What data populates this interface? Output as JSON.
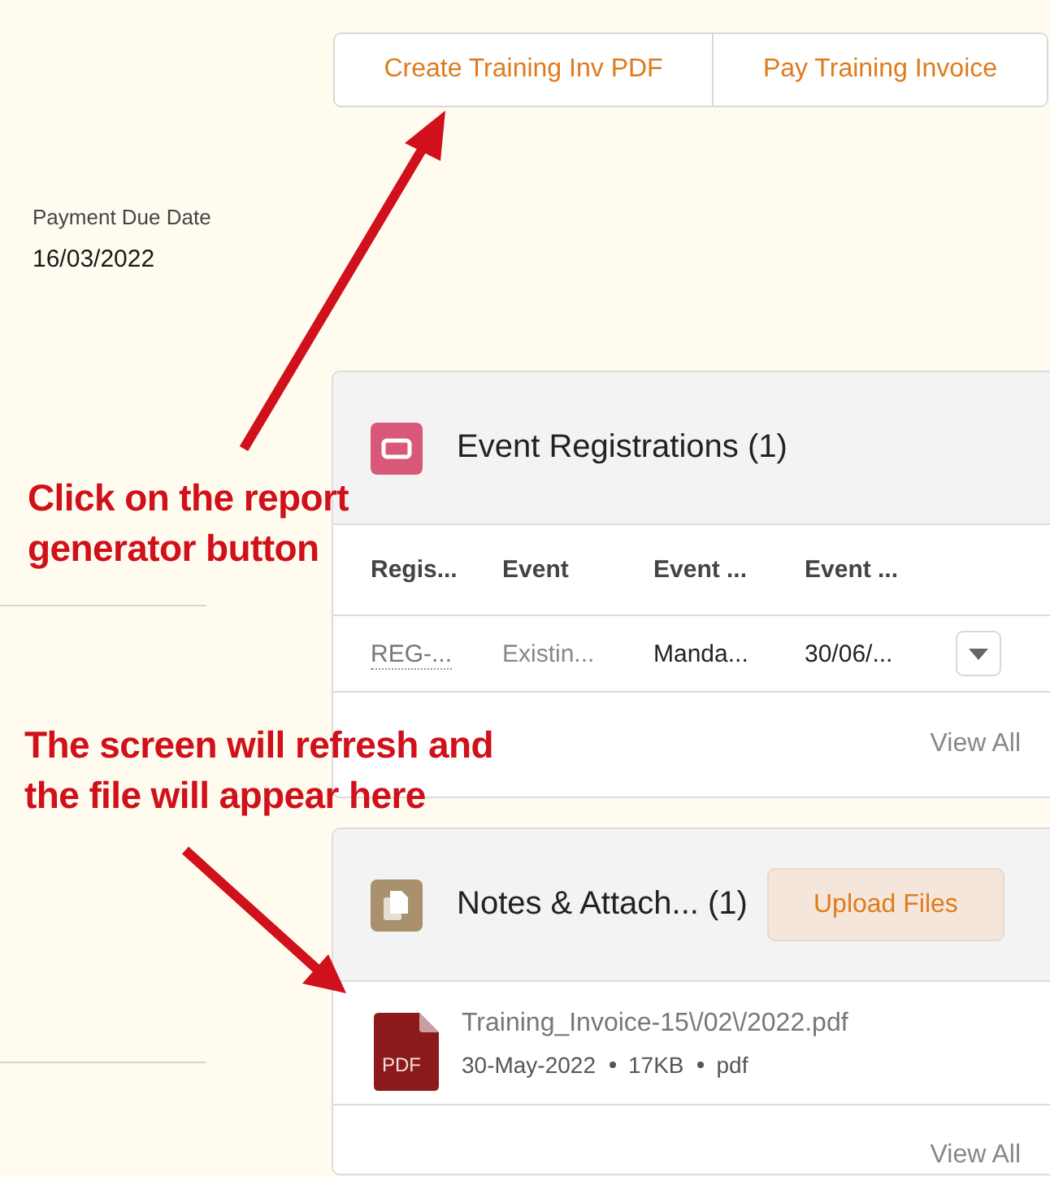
{
  "buttons": [
    {
      "label": "Create Training Inv PDF"
    },
    {
      "label": "Pay Training Invoice"
    }
  ],
  "fields": [
    {
      "label": "Payment Due Date",
      "value": "16/03/2022"
    }
  ],
  "event_registrations": {
    "title": "Event Registrations (1)",
    "columns": [
      "Regis...",
      "Event",
      "Event ...",
      "Event ..."
    ],
    "rows": [
      {
        "cells": [
          {
            "text": "REG-...",
            "kind": "link"
          },
          {
            "text": "Existin...",
            "kind": "muted"
          },
          {
            "text": "Manda...",
            "kind": "plain"
          },
          {
            "text": "30/06/...",
            "kind": "plain"
          }
        ]
      }
    ],
    "view_all": "View All"
  },
  "notes_attachments": {
    "title": "Notes & Attach... (1)",
    "upload_button": "Upload Files",
    "files": [
      {
        "name": "Training_Invoice-15\\/02\\/2022.pdf",
        "icon_label": "PDF",
        "meta": [
          "30-May-2022",
          "17KB",
          "pdf"
        ]
      }
    ],
    "view_all": "View All"
  },
  "annotations": [
    {
      "lines": [
        "Click on the report",
        "generator button"
      ]
    },
    {
      "lines": [
        "The screen will refresh and",
        "the file will appear here"
      ]
    }
  ]
}
